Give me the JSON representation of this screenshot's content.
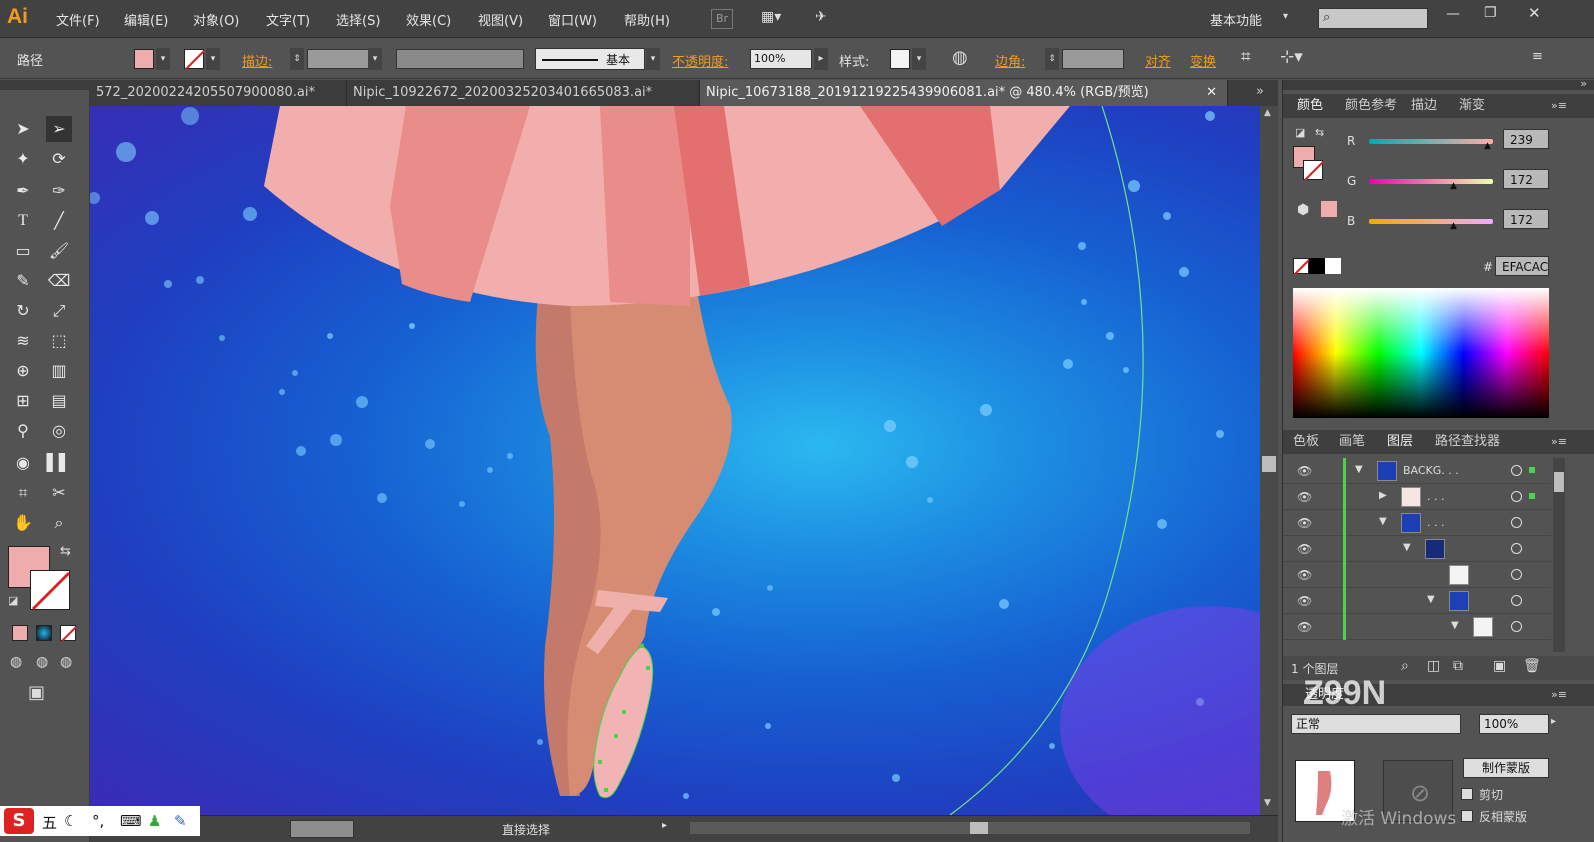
{
  "app": {
    "logo": "Ai"
  },
  "menus": [
    "文件(F)",
    "编辑(E)",
    "对象(O)",
    "文字(T)",
    "选择(S)",
    "效果(C)",
    "视图(V)",
    "窗口(W)",
    "帮助(H)"
  ],
  "menubar_right": {
    "br_label": "Br",
    "workspace": "基本功能"
  },
  "control": {
    "object_type": "路径",
    "stroke_label": "描边:",
    "brush_label": "基本",
    "opacity_label": "不透明度:",
    "opacity_value": "100%",
    "style_label": "样式:",
    "corner_label": "边角:",
    "align_label": "对齐",
    "transform_label": "变换"
  },
  "tabs": [
    {
      "label": "572_20200224205507900080.ai*",
      "active": false
    },
    {
      "label": "Nipic_10922672_20200325203401665083.ai*",
      "active": false
    },
    {
      "label": "Nipic_10673188_20191219225439906081.ai* @ 480.4% (RGB/预览)",
      "active": true
    }
  ],
  "color_panel": {
    "tabs": [
      "颜色",
      "颜色参考",
      "描边",
      "渐变"
    ],
    "r_label": "R",
    "r_value": "239",
    "g_label": "G",
    "g_value": "172",
    "b_label": "B",
    "b_value": "172",
    "hex_label": "#",
    "hex_value": "EFACAC",
    "fill_color": "#EFACAC"
  },
  "layers_panel": {
    "tabs": [
      "色板",
      "画笔",
      "图层",
      "路径查找器"
    ],
    "rows": [
      {
        "name": "BACKG. . ."
      },
      {
        "name": ". . ."
      },
      {
        "name": ". . ."
      },
      {
        "name": ""
      },
      {
        "name": ""
      },
      {
        "name": ""
      },
      {
        "name": ""
      }
    ],
    "footer": "1 个图层"
  },
  "transparency_panel": {
    "title": "透明度",
    "mode": "正常",
    "opacity": "100%",
    "make_mask": "制作蒙版",
    "clip": "剪切",
    "invert_mask": "反相蒙版"
  },
  "statusbar": {
    "tool_name": "直接选择"
  },
  "watermark": {
    "text": "激活 Windows",
    "brand": "Z99N"
  },
  "ime": {
    "label": "五"
  },
  "colors": {
    "skirt_light": "#F2ADAD",
    "skirt_mid": "#E98C8A",
    "skirt_dark": "#E46F6F",
    "leg": "#D68C72",
    "leg_shadow": "#C47A6A",
    "shoe": "#F1B3B3",
    "accent": "#F39B21"
  }
}
